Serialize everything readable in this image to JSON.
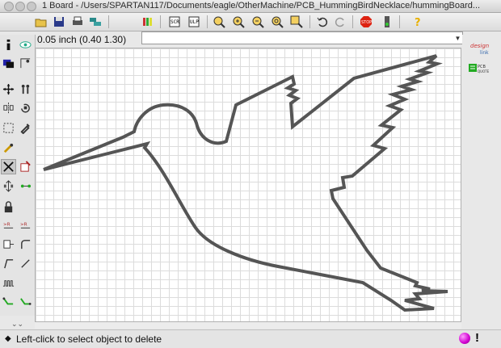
{
  "window": {
    "title": "1 Board - /Users/SPARTAN117/Documents/eagle/OtherMachine/PCB_HummingBirdNecklace/hummingBoard..."
  },
  "toolbar": {
    "icons": [
      "open-icon",
      "save-icon",
      "print-icon",
      "cam-icon",
      "library-icon",
      "script-icon",
      "ulp-icon",
      "zoom-fit-icon",
      "zoom-in-icon",
      "zoom-out-icon",
      "zoom-redraw-icon",
      "zoom-select-icon",
      "undo-icon",
      "redo-icon",
      "stop-icon",
      "go-icon",
      "help-icon"
    ]
  },
  "coordbar": {
    "coordinates": "0.05 inch (0.40 1.30)",
    "command_value": ""
  },
  "right_panel": {
    "logo_line1": "design",
    "logo_line2": "link",
    "pcb_quote_line1": "PCB",
    "pcb_quote_line2": "QUOTE"
  },
  "status": {
    "message": "Left-click to select object to delete"
  },
  "colors": {
    "outline": "#555555",
    "grid": "#dcdcdc",
    "status_ball": "#d000d0"
  }
}
